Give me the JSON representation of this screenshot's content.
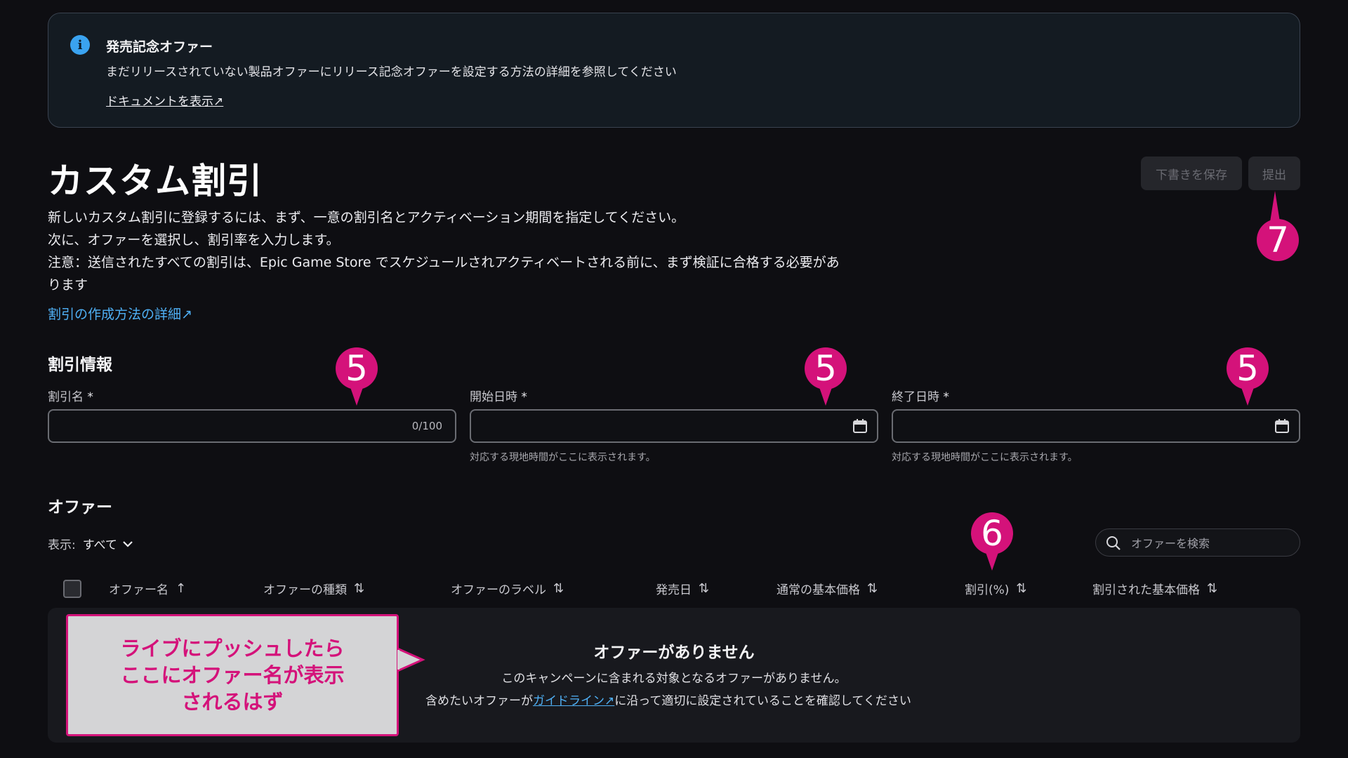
{
  "banner": {
    "title": "発売記念オファー",
    "body": "まだリリースされていない製品オファーにリリース記念オファーを設定する方法の詳細を参照してください",
    "link": "ドキュメントを表示↗"
  },
  "header": {
    "title": "カスタム割引",
    "description": [
      "新しいカスタム割引に登録するには、まず、一意の割引名とアクティベーション期間を指定してください。",
      "次に、オファーを選択し、割引率を入力します。",
      "注意：送信されたすべての割引は、Epic Game Store でスケジュールされアクティベートされる前に、まず検証に合格する必要があ",
      "ります"
    ],
    "learn_link": "割引の作成方法の詳細↗",
    "save_draft_label": "下書きを保存",
    "submit_label": "提出"
  },
  "discount_info": {
    "section_title": "割引情報",
    "name_label": "割引名",
    "name_value": "",
    "name_counter": "0/100",
    "start_label": "開始日時",
    "start_value": "",
    "start_helper": "対応する現地時間がここに表示されます。",
    "end_label": "終了日時",
    "end_value": "",
    "end_helper": "対応する現地時間がここに表示されます。",
    "required_mark": "*"
  },
  "offers": {
    "section_title": "オファー",
    "filter_label": "表示:",
    "filter_value": "すべて",
    "search_placeholder": "オファーを検索",
    "columns": [
      "オファー名",
      "オファーの種類",
      "オファーのラベル",
      "発売日",
      "通常の基本価格",
      "割引(%)",
      "割引された基本価格"
    ],
    "empty_title": "オファーがありません",
    "empty_body": "このキャンペーンに含まれる対象となるオファーがありません。",
    "empty_body2_prefix": "含めたいオファーが",
    "empty_body2_link": "ガイドライン↗",
    "empty_body2_suffix": "に沿って適切に設定されていることを確認してください"
  },
  "annotations": {
    "badge_5": "5",
    "badge_6": "6",
    "badge_7": "7",
    "callout": "ライブにプッシュしたら\nここにオファー名が表示\nされるはず",
    "badge_color": "#d4127a"
  }
}
